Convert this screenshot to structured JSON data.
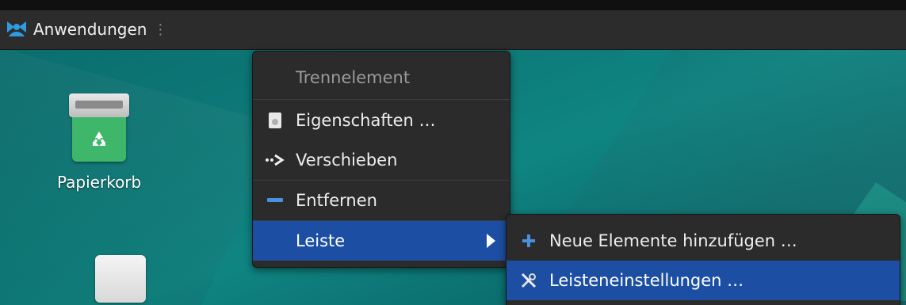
{
  "panel": {
    "apps_label": "Anwendungen",
    "handle_glyph": "⋮"
  },
  "desktop": {
    "icons": [
      {
        "label": "Papierkorb",
        "icon": "trash-icon"
      },
      {
        "label": "",
        "icon": "drive-icon"
      }
    ]
  },
  "context_menu": {
    "header": "Trennelement",
    "items": [
      {
        "label": "Eigenschaften …",
        "icon": "properties-icon"
      },
      {
        "label": "Verschieben",
        "icon": "move-icon"
      },
      {
        "label": "Entfernen",
        "icon": "remove-icon"
      },
      {
        "label": "Leiste",
        "icon": "",
        "has_submenu": true,
        "highlighted": true
      }
    ]
  },
  "submenu": {
    "items": [
      {
        "label": "Neue Elemente hinzufügen …",
        "icon": "add-icon"
      },
      {
        "label": "Leisteneinstellungen …",
        "icon": "settings-icon",
        "highlighted": true
      }
    ]
  },
  "colors": {
    "highlight": "#1c4fa4",
    "menu_bg": "#2b2b2b",
    "panel_bg": "#2c2c2c",
    "desktop": "#0d7a78"
  }
}
